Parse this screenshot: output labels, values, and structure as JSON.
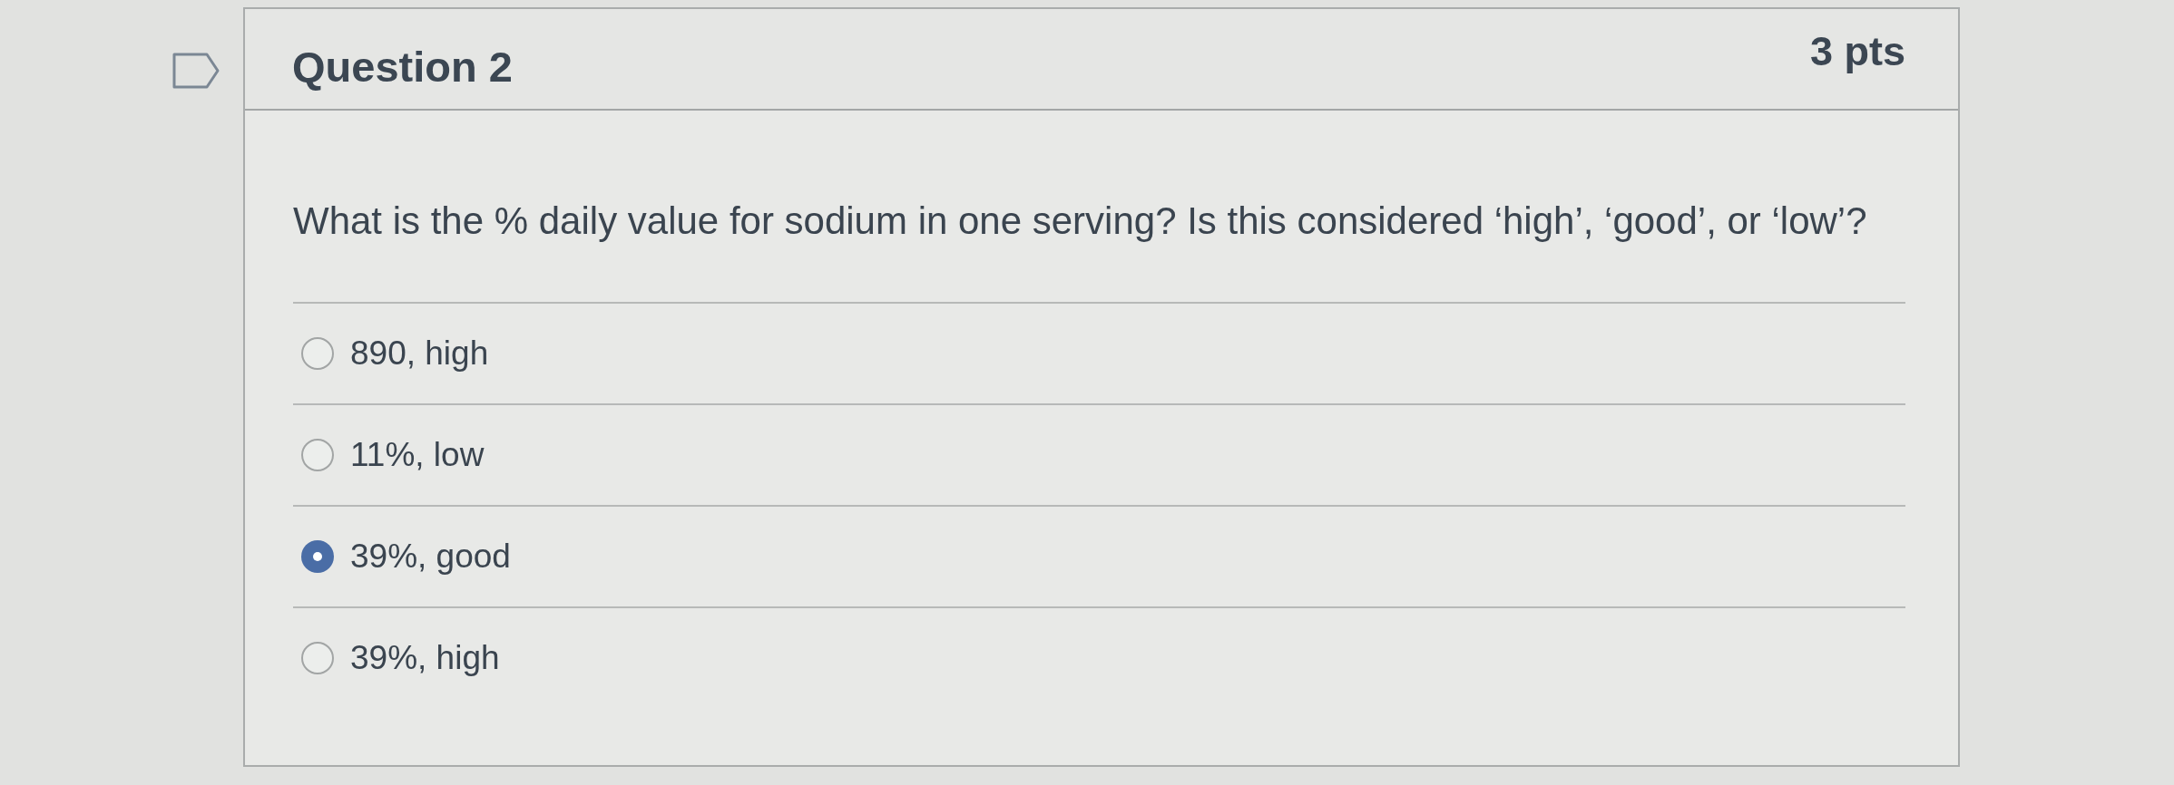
{
  "question": {
    "flagged": false,
    "title": "Question 2",
    "points": "3 pts",
    "text": "What is the % daily value for sodium in one serving? Is this considered ‘high’, ‘good’, or ‘low’?",
    "answers": [
      {
        "label": "890, high",
        "selected": false
      },
      {
        "label": "11%, low",
        "selected": false
      },
      {
        "label": "39%, good",
        "selected": true
      },
      {
        "label": "39%, high",
        "selected": false
      }
    ]
  }
}
